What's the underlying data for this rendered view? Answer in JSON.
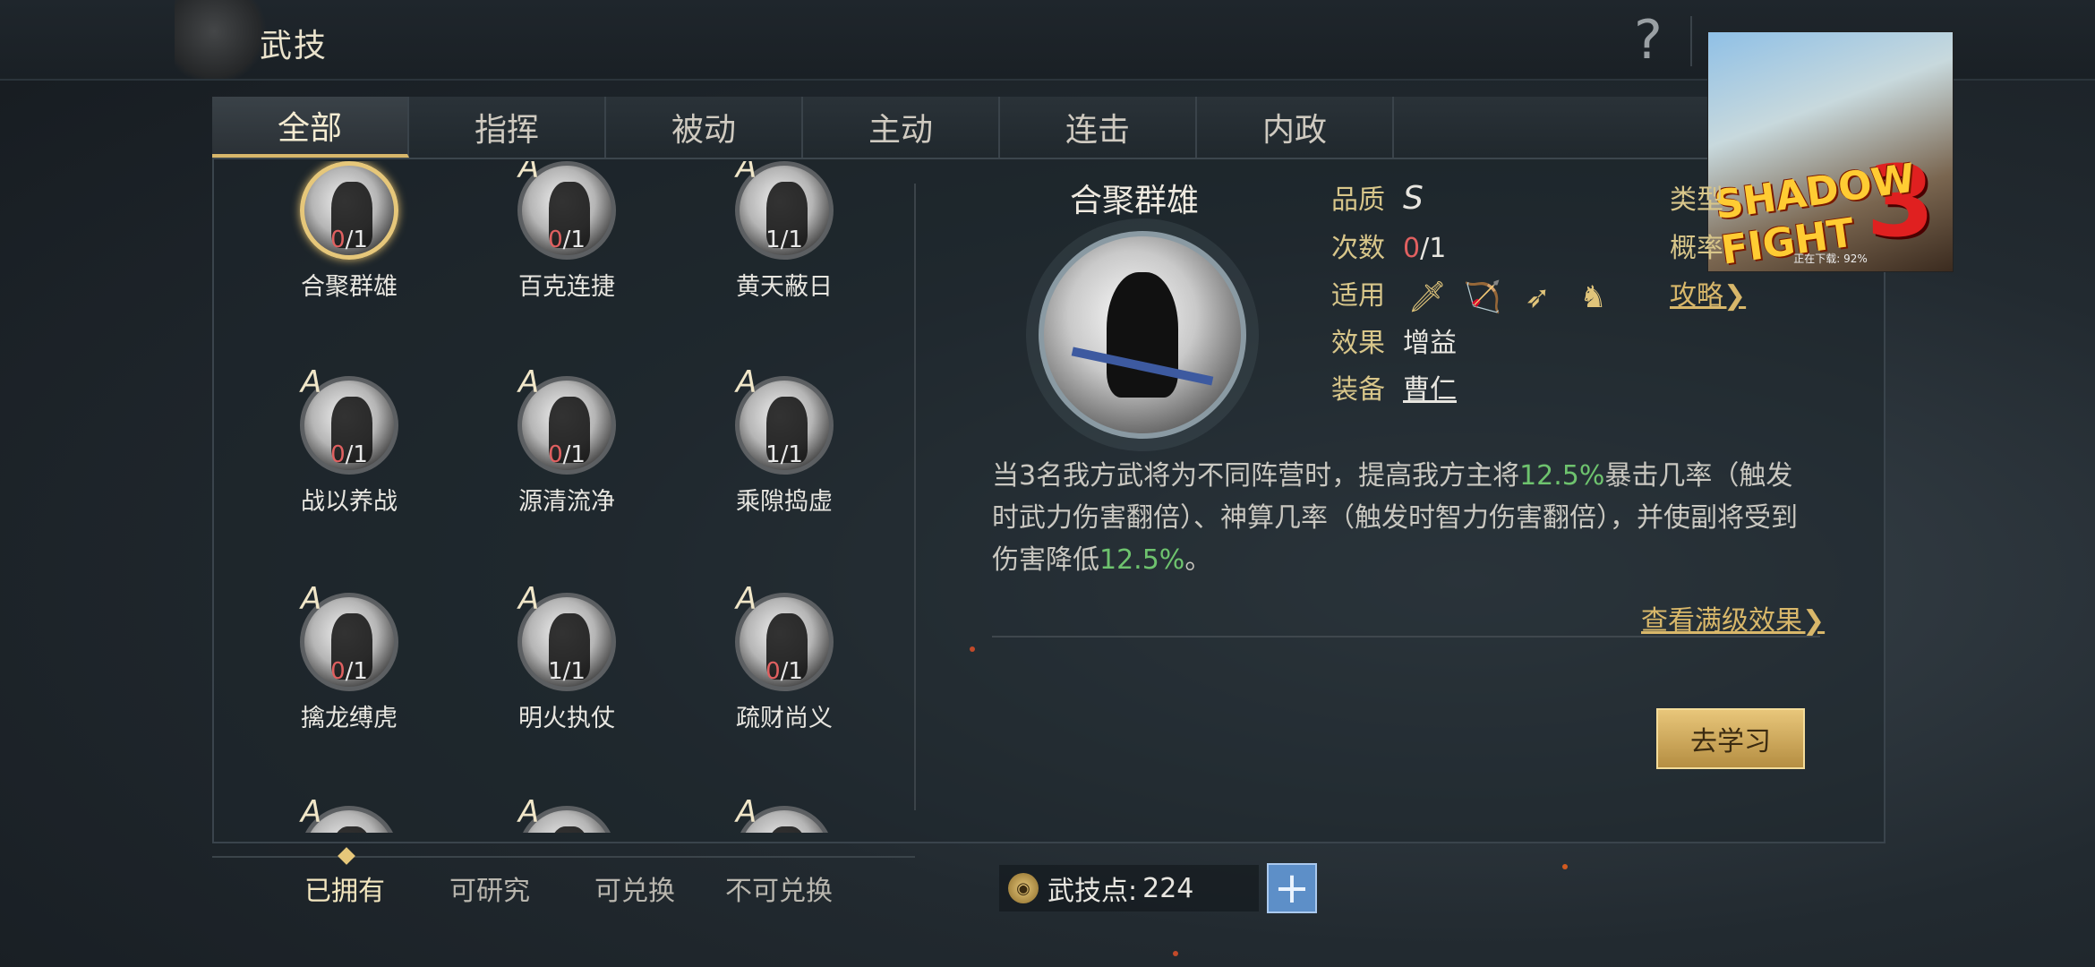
{
  "header": {
    "title": "武技",
    "help_glyph": "?"
  },
  "ad": {
    "logo": "SHADOW FIGHT",
    "number": "3",
    "progress_text": "正在下载: 92%"
  },
  "tabs": [
    {
      "label": "全部",
      "active": true
    },
    {
      "label": "指挥",
      "active": false
    },
    {
      "label": "被动",
      "active": false
    },
    {
      "label": "主动",
      "active": false
    },
    {
      "label": "连击",
      "active": false
    },
    {
      "label": "内政",
      "active": false
    }
  ],
  "skills": [
    {
      "name": "合聚群雄",
      "grade": "",
      "owned": "0",
      "total": "/1"
    },
    {
      "name": "百克连捷",
      "grade": "A",
      "owned": "0",
      "total": "/1"
    },
    {
      "name": "黄天蔽日",
      "grade": "A",
      "owned": "1",
      "total": "/1"
    },
    {
      "name": "战以养战",
      "grade": "A",
      "owned": "0",
      "total": "/1"
    },
    {
      "name": "源清流净",
      "grade": "A",
      "owned": "0",
      "total": "/1"
    },
    {
      "name": "乘隙捣虚",
      "grade": "A",
      "owned": "1",
      "total": "/1"
    },
    {
      "name": "擒龙缚虎",
      "grade": "A",
      "owned": "0",
      "total": "/1"
    },
    {
      "name": "明火执仗",
      "grade": "A",
      "owned": "1",
      "total": "/1"
    },
    {
      "name": "疏财尚义",
      "grade": "A",
      "owned": "0",
      "total": "/1"
    },
    {
      "name": "",
      "grade": "A",
      "owned": "",
      "total": ""
    },
    {
      "name": "",
      "grade": "A",
      "owned": "",
      "total": ""
    },
    {
      "name": "",
      "grade": "A",
      "owned": "",
      "total": ""
    }
  ],
  "detail": {
    "name": "合聚群雄",
    "quality_label": "品质",
    "quality_value": "S",
    "count_label": "次数",
    "count_owned": "0",
    "count_total": "/1",
    "suit_label": "适用",
    "weapons": [
      "sword-icon",
      "bow-icon",
      "spear-icon",
      "horse-icon"
    ],
    "effect_label": "效果",
    "effect_value": "增益",
    "equip_label": "装备",
    "equip_value": "曹仁",
    "type_label": "类型",
    "prob_label": "概率",
    "guide_link": "攻略",
    "desc_1": "当3名我方武将为不同阵营时，提高我方主将",
    "desc_hl1": "12.5%",
    "desc_2": "暴击几率（触发时武力伤害翻倍）、神算几率（触发时智力伤害翻倍），并使副将受到伤害降低",
    "desc_hl2": "12.5%",
    "desc_3": "。",
    "full_effect_link": "查看满级效果",
    "learn_button": "去学习"
  },
  "filters": [
    {
      "label": "已拥有",
      "active": true
    },
    {
      "label": "可研究",
      "active": false
    },
    {
      "label": "可兑换",
      "active": false
    },
    {
      "label": "不可兑换",
      "active": false
    }
  ],
  "points": {
    "label": "武技点:",
    "value": "224",
    "plus": "+"
  },
  "colors": {
    "gold": "#d8b76a",
    "highlight_green": "#6ec36e",
    "count_red": "#e06060"
  }
}
